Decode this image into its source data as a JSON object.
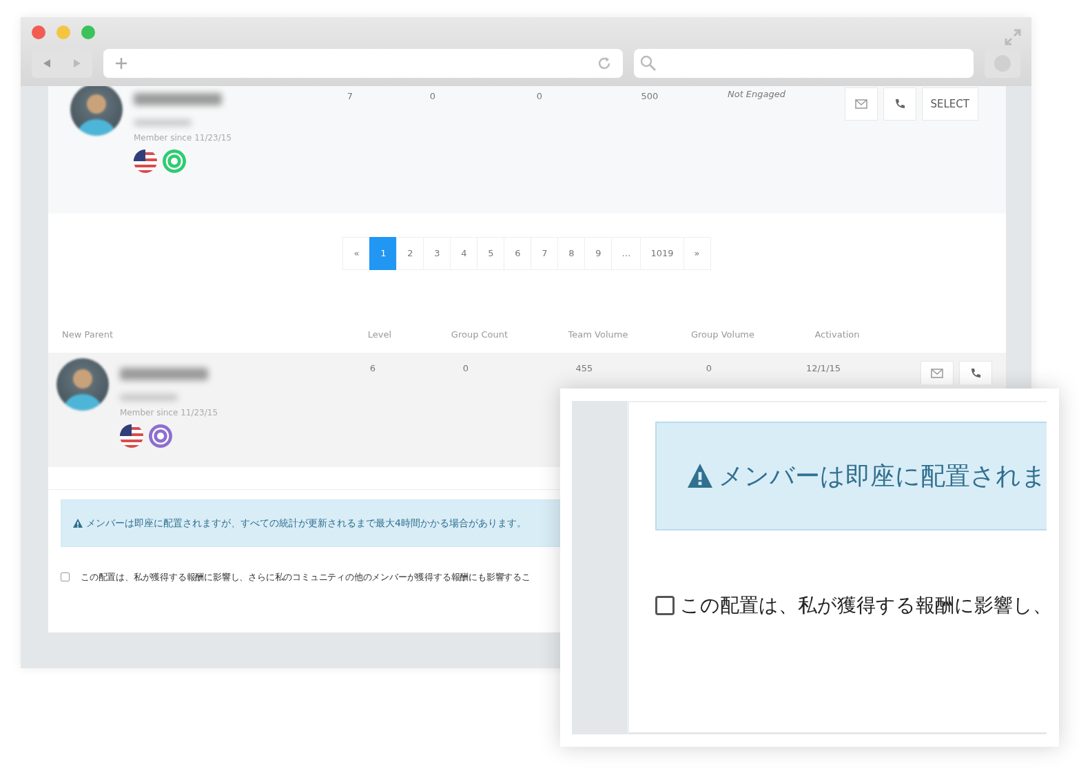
{
  "members": [
    {
      "kind": "plain",
      "level": "7",
      "group_count": "0",
      "team_volume": "0",
      "group_volume": "500",
      "activation": "Not Engaged",
      "member_since": "Member since 11/23/15",
      "badge": {
        "color": "#2ecc71"
      },
      "actions": [
        "SELECT"
      ]
    },
    {
      "kind": "table",
      "level": "6",
      "group_count": "0",
      "team_volume": "455",
      "group_volume": "0",
      "activation": "12/1/15",
      "member_since": "Member since 11/23/15",
      "badge": {
        "color": "#8e6fd0"
      }
    }
  ],
  "pagination": {
    "prev": "«",
    "next": "»",
    "pages": [
      {
        "label": "1",
        "selected": true
      },
      {
        "label": "2",
        "selected": false
      },
      {
        "label": "3",
        "selected": false
      },
      {
        "label": "4",
        "selected": false
      },
      {
        "label": "5",
        "selected": false
      },
      {
        "label": "6",
        "selected": false
      },
      {
        "label": "7",
        "selected": false
      },
      {
        "label": "8",
        "selected": false
      },
      {
        "label": "9",
        "selected": false
      },
      {
        "label": "…",
        "selected": false
      },
      {
        "label": "1019",
        "selected": false
      }
    ]
  },
  "table": {
    "columns": [
      "New Parent",
      "Level",
      "Group Count",
      "Team Volume",
      "Group Volume",
      "Activation"
    ]
  },
  "alert": {
    "text": "メンバーは即座に配置されますが、すべての統計が更新されるまで最大4時間かかる場合があります。"
  },
  "agreement": {
    "checked": false,
    "text": "この配置は、私が獲得する報酬に影響し、さらに私のコミュニティの他のメンバーが獲得する報酬にも影響するこ"
  },
  "zoom_inset": {
    "alert_text": "メンバーは即座に配置されま",
    "checkbox_text": "この配置は、私が獲得する報酬に影響し、",
    "checked": false
  }
}
